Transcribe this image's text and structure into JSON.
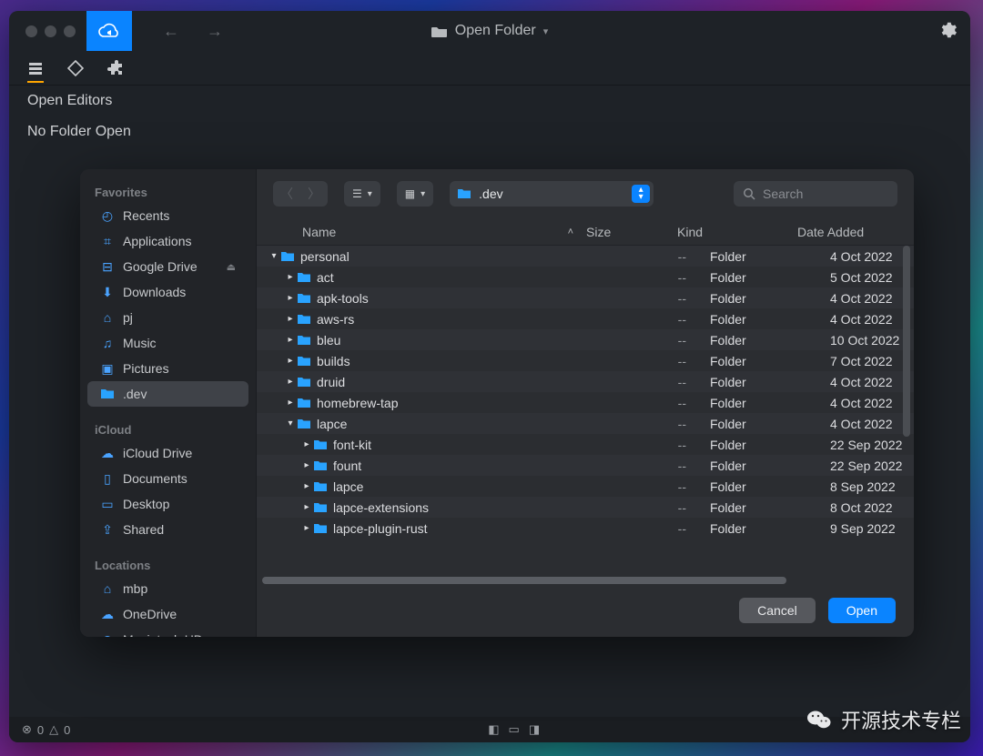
{
  "window": {
    "title": "Open Folder",
    "panel": {
      "open_editors": "Open Editors",
      "no_folder": "No Folder Open"
    },
    "status": {
      "errors": "0",
      "warnings": "0"
    }
  },
  "dialog": {
    "path_label": ".dev",
    "search_placeholder": "Search",
    "columns": {
      "name": "Name",
      "size": "Size",
      "kind": "Kind",
      "date": "Date Added"
    },
    "buttons": {
      "cancel": "Cancel",
      "open": "Open"
    },
    "sidebar": {
      "sections": [
        {
          "title": "Favorites",
          "items": [
            {
              "icon": "clock",
              "label": "Recents"
            },
            {
              "icon": "apps",
              "label": "Applications"
            },
            {
              "icon": "drive",
              "label": "Google Drive",
              "eject": true
            },
            {
              "icon": "download",
              "label": "Downloads"
            },
            {
              "icon": "home",
              "label": "pj"
            },
            {
              "icon": "music",
              "label": "Music"
            },
            {
              "icon": "image",
              "label": "Pictures"
            },
            {
              "icon": "folder",
              "label": ".dev",
              "selected": true
            }
          ]
        },
        {
          "title": "iCloud",
          "items": [
            {
              "icon": "cloud",
              "label": "iCloud Drive"
            },
            {
              "icon": "doc",
              "label": "Documents"
            },
            {
              "icon": "desktop",
              "label": "Desktop"
            },
            {
              "icon": "share",
              "label": "Shared"
            }
          ]
        },
        {
          "title": "Locations",
          "items": [
            {
              "icon": "laptop",
              "label": "mbp"
            },
            {
              "icon": "cloud2",
              "label": "OneDrive"
            },
            {
              "icon": "disk",
              "label": "Macintosh HD"
            }
          ]
        }
      ]
    },
    "files": [
      {
        "indent": 0,
        "open": true,
        "name": "personal",
        "size": "--",
        "kind": "Folder",
        "date": "4 Oct 2022"
      },
      {
        "indent": 1,
        "open": false,
        "name": "act",
        "size": "--",
        "kind": "Folder",
        "date": "5 Oct 2022"
      },
      {
        "indent": 1,
        "open": false,
        "name": "apk-tools",
        "size": "--",
        "kind": "Folder",
        "date": "4 Oct 2022"
      },
      {
        "indent": 1,
        "open": false,
        "name": "aws-rs",
        "size": "--",
        "kind": "Folder",
        "date": "4 Oct 2022"
      },
      {
        "indent": 1,
        "open": false,
        "name": "bleu",
        "size": "--",
        "kind": "Folder",
        "date": "10 Oct 2022"
      },
      {
        "indent": 1,
        "open": false,
        "name": "builds",
        "size": "--",
        "kind": "Folder",
        "date": "7 Oct 2022"
      },
      {
        "indent": 1,
        "open": false,
        "name": "druid",
        "size": "--",
        "kind": "Folder",
        "date": "4 Oct 2022"
      },
      {
        "indent": 1,
        "open": false,
        "name": "homebrew-tap",
        "size": "--",
        "kind": "Folder",
        "date": "4 Oct 2022"
      },
      {
        "indent": 1,
        "open": true,
        "name": "lapce",
        "size": "--",
        "kind": "Folder",
        "date": "4 Oct 2022"
      },
      {
        "indent": 2,
        "open": false,
        "name": "font-kit",
        "size": "--",
        "kind": "Folder",
        "date": "22 Sep 2022"
      },
      {
        "indent": 2,
        "open": false,
        "name": "fount",
        "size": "--",
        "kind": "Folder",
        "date": "22 Sep 2022"
      },
      {
        "indent": 2,
        "open": false,
        "name": "lapce",
        "size": "--",
        "kind": "Folder",
        "date": "8 Sep 2022"
      },
      {
        "indent": 2,
        "open": false,
        "name": "lapce-extensions",
        "size": "--",
        "kind": "Folder",
        "date": "8 Oct 2022"
      },
      {
        "indent": 2,
        "open": false,
        "name": "lapce-plugin-rust",
        "size": "--",
        "kind": "Folder",
        "date": "9 Sep 2022"
      }
    ]
  },
  "watermark": "开源技术专栏"
}
